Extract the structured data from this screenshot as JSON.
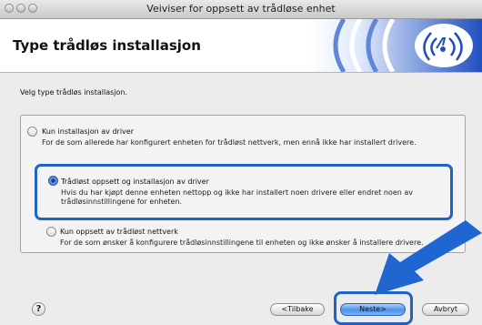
{
  "window": {
    "title": "Veiviser for oppsett av trådløse enhet"
  },
  "header": {
    "title": "Type trådløs installasjon"
  },
  "instruction": "Velg type trådløs installasjon.",
  "options": [
    {
      "label": "Kun installasjon av driver",
      "description": "For de som allerede har konfigurert enheten for trådløst nettverk, men ennå ikke har installert drivere.",
      "selected": false
    },
    {
      "label": "Trådløst oppsett og installasjon av driver",
      "description": "Hvis du har kjøpt denne enheten nettopp og ikke har installert noen drivere eller endret noen av trådløsinnstillingene for enheten.",
      "selected": true
    },
    {
      "label": "Kun oppsett av trådløst nettverk",
      "description": "For de som ønsker å konfigurere trådløsinnstillingene til enheten og ikke ønsker å installere drivere.",
      "selected": false
    }
  ],
  "buttons": {
    "help": "?",
    "back": "<Tilbake",
    "next": "Neste>",
    "cancel": "Avbryt"
  },
  "colors": {
    "highlight": "#1e63c9",
    "banner_blue": "#1f4fbf"
  },
  "icons": {
    "banner": "wireless-signal-icon",
    "help": "help-icon",
    "pointer": "arrow-pointer-icon"
  }
}
